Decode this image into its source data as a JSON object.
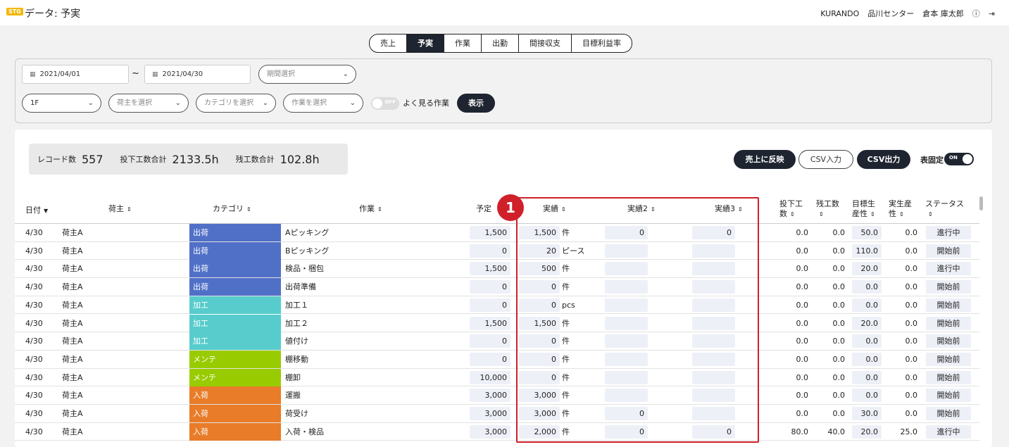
{
  "header": {
    "env_badge": "STG",
    "title": "データ: 予実",
    "company": "KURANDO",
    "center": "品川センター",
    "user": "倉本 庫太郎",
    "help_icon": "help-circle-icon",
    "logout_icon": "logout-icon"
  },
  "tabs": [
    {
      "label": "売上",
      "active": false
    },
    {
      "label": "予実",
      "active": true
    },
    {
      "label": "作業",
      "active": false
    },
    {
      "label": "出勤",
      "active": false
    },
    {
      "label": "間接収支",
      "active": false
    },
    {
      "label": "目標利益率",
      "active": false
    }
  ],
  "filters": {
    "date_from": "2021/04/01",
    "date_to": "2021/04/30",
    "tilde": "~",
    "period_placeholder": "期間選択",
    "floor": "1F",
    "shipper_placeholder": "荷主を選択",
    "category_placeholder": "カテゴリを選択",
    "work_placeholder": "作業を選択",
    "frequent_toggle": "OFF",
    "frequent_label": "よく見る作業",
    "show_button": "表示"
  },
  "summary": {
    "records_label": "レコード数",
    "records_value": "557",
    "input_hours_label": "投下工数合計",
    "input_hours_value": "2133.5h",
    "overtime_label": "残工数合計",
    "overtime_value": "102.8h"
  },
  "actions": {
    "reflect_sales": "売上に反映",
    "csv_import": "CSV入力",
    "csv_export": "CSV出力",
    "fix_header_label": "表固定",
    "fix_header_toggle": "ON"
  },
  "table": {
    "headers": {
      "date": "日付",
      "shipper": "荷主",
      "category": "カテゴリ",
      "work": "作業",
      "plan": "予定",
      "actual": "実績",
      "actual2": "実績2",
      "actual3": "実績3",
      "input_hours_1": "投下工",
      "input_hours_2": "数",
      "remaining_hours": "残工数",
      "target_prod_1": "目標生",
      "target_prod_2": "産性",
      "actual_prod_1": "実生産",
      "actual_prod_2": "性",
      "status": "ステータス"
    },
    "rows": [
      {
        "date": "4/30",
        "shipper": "荷主A",
        "category": "出荷",
        "cat_color": "#5070c8",
        "work": "Aピッキング",
        "plan": "1,500",
        "actual": "1,500",
        "unit": "件",
        "actual2": "0",
        "actual3": "0",
        "input": "0.0",
        "remain": "0.0",
        "target": "50.0",
        "prod": "0.0",
        "status": "進行中"
      },
      {
        "date": "4/30",
        "shipper": "荷主A",
        "category": "出荷",
        "cat_color": "#5070c8",
        "work": "Bピッキング",
        "plan": "0",
        "actual": "20",
        "unit": "ピース",
        "actual2": "",
        "actual3": "",
        "input": "0.0",
        "remain": "0.0",
        "target": "110.0",
        "prod": "0.0",
        "status": "開始前"
      },
      {
        "date": "4/30",
        "shipper": "荷主A",
        "category": "出荷",
        "cat_color": "#5070c8",
        "work": "検品・梱包",
        "plan": "1,500",
        "actual": "500",
        "unit": "件",
        "actual2": "",
        "actual3": "",
        "input": "0.0",
        "remain": "0.0",
        "target": "20.0",
        "prod": "0.0",
        "status": "進行中"
      },
      {
        "date": "4/30",
        "shipper": "荷主A",
        "category": "出荷",
        "cat_color": "#5070c8",
        "work": "出荷準備",
        "plan": "0",
        "actual": "0",
        "unit": "件",
        "actual2": "",
        "actual3": "",
        "input": "0.0",
        "remain": "0.0",
        "target": "0.0",
        "prod": "0.0",
        "status": "開始前"
      },
      {
        "date": "4/30",
        "shipper": "荷主A",
        "category": "加工",
        "cat_color": "#58cccc",
        "work": "加工１",
        "plan": "0",
        "actual": "0",
        "unit": "pcs",
        "actual2": "",
        "actual3": "",
        "input": "0.0",
        "remain": "0.0",
        "target": "0.0",
        "prod": "0.0",
        "status": "開始前"
      },
      {
        "date": "4/30",
        "shipper": "荷主A",
        "category": "加工",
        "cat_color": "#58cccc",
        "work": "加工２",
        "plan": "1,500",
        "actual": "1,500",
        "unit": "件",
        "actual2": "",
        "actual3": "",
        "input": "0.0",
        "remain": "0.0",
        "target": "20.0",
        "prod": "0.0",
        "status": "開始前"
      },
      {
        "date": "4/30",
        "shipper": "荷主A",
        "category": "加工",
        "cat_color": "#58cccc",
        "work": "値付け",
        "plan": "0",
        "actual": "0",
        "unit": "件",
        "actual2": "",
        "actual3": "",
        "input": "0.0",
        "remain": "0.0",
        "target": "0.0",
        "prod": "0.0",
        "status": "開始前"
      },
      {
        "date": "4/30",
        "shipper": "荷主A",
        "category": "メンテ",
        "cat_color": "#99cc00",
        "work": "棚移動",
        "plan": "0",
        "actual": "0",
        "unit": "件",
        "actual2": "",
        "actual3": "",
        "input": "0.0",
        "remain": "0.0",
        "target": "0.0",
        "prod": "0.0",
        "status": "開始前"
      },
      {
        "date": "4/30",
        "shipper": "荷主A",
        "category": "メンテ",
        "cat_color": "#99cc00",
        "work": "棚卸",
        "plan": "10,000",
        "actual": "0",
        "unit": "件",
        "actual2": "",
        "actual3": "",
        "input": "0.0",
        "remain": "0.0",
        "target": "0.0",
        "prod": "0.0",
        "status": "開始前"
      },
      {
        "date": "4/30",
        "shipper": "荷主A",
        "category": "入荷",
        "cat_color": "#e87c28",
        "work": "運搬",
        "plan": "3,000",
        "actual": "3,000",
        "unit": "件",
        "actual2": "",
        "actual3": "",
        "input": "0.0",
        "remain": "0.0",
        "target": "0.0",
        "prod": "0.0",
        "status": "開始前"
      },
      {
        "date": "4/30",
        "shipper": "荷主A",
        "category": "入荷",
        "cat_color": "#e87c28",
        "work": "荷受け",
        "plan": "3,000",
        "actual": "3,000",
        "unit": "件",
        "actual2": "0",
        "actual3": "",
        "input": "0.0",
        "remain": "0.0",
        "target": "30.0",
        "prod": "0.0",
        "status": "開始前"
      },
      {
        "date": "4/30",
        "shipper": "荷主A",
        "category": "入荷",
        "cat_color": "#e87c28",
        "work": "入荷・検品",
        "plan": "3,000",
        "actual": "2,000",
        "unit": "件",
        "actual2": "0",
        "actual3": "0",
        "input": "80.0",
        "remain": "40.0",
        "target": "20.0",
        "prod": "25.0",
        "status": "進行中"
      }
    ]
  },
  "annotation": {
    "marker": "1"
  }
}
